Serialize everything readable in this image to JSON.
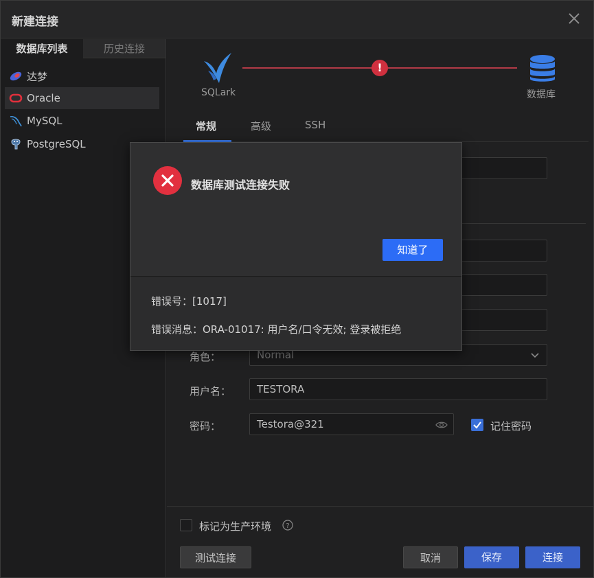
{
  "window": {
    "title": "新建连接"
  },
  "sidebar": {
    "tabs": [
      {
        "label": "数据库列表"
      },
      {
        "label": "历史连接"
      }
    ],
    "items": [
      {
        "label": "达梦",
        "icon": "dameng-icon"
      },
      {
        "label": "Oracle",
        "icon": "oracle-icon"
      },
      {
        "label": "MySQL",
        "icon": "mysql-icon"
      },
      {
        "label": "PostgreSQL",
        "icon": "postgresql-icon"
      }
    ]
  },
  "flow": {
    "source_label": "SQLark",
    "target_label": "数据库",
    "status_mark": "!"
  },
  "tabs": [
    {
      "label": "常规"
    },
    {
      "label": "高级"
    },
    {
      "label": "SSH"
    }
  ],
  "form": {
    "role_label": "角色：",
    "role_value": "Normal",
    "user_label": "用户名：",
    "user_value": "TESTORA",
    "password_label": "密码：",
    "password_value": "Testora@321",
    "remember_label": "记住密码",
    "remember_checked": true
  },
  "footer": {
    "production_label": "标记为生产环境",
    "test_button": "测试连接",
    "cancel_button": "取消",
    "save_button": "保存",
    "connect_button": "连接"
  },
  "modal": {
    "title": "数据库测试连接失败",
    "ok_button": "知道了",
    "error_code_line": "错误号：[1017]",
    "error_message_line": "错误消息：ORA-01017: 用户名/口令无效; 登录被拒绝"
  },
  "colors": {
    "accent": "#2c6cf6",
    "error": "#e2303f",
    "flow_line": "#b33a47"
  }
}
